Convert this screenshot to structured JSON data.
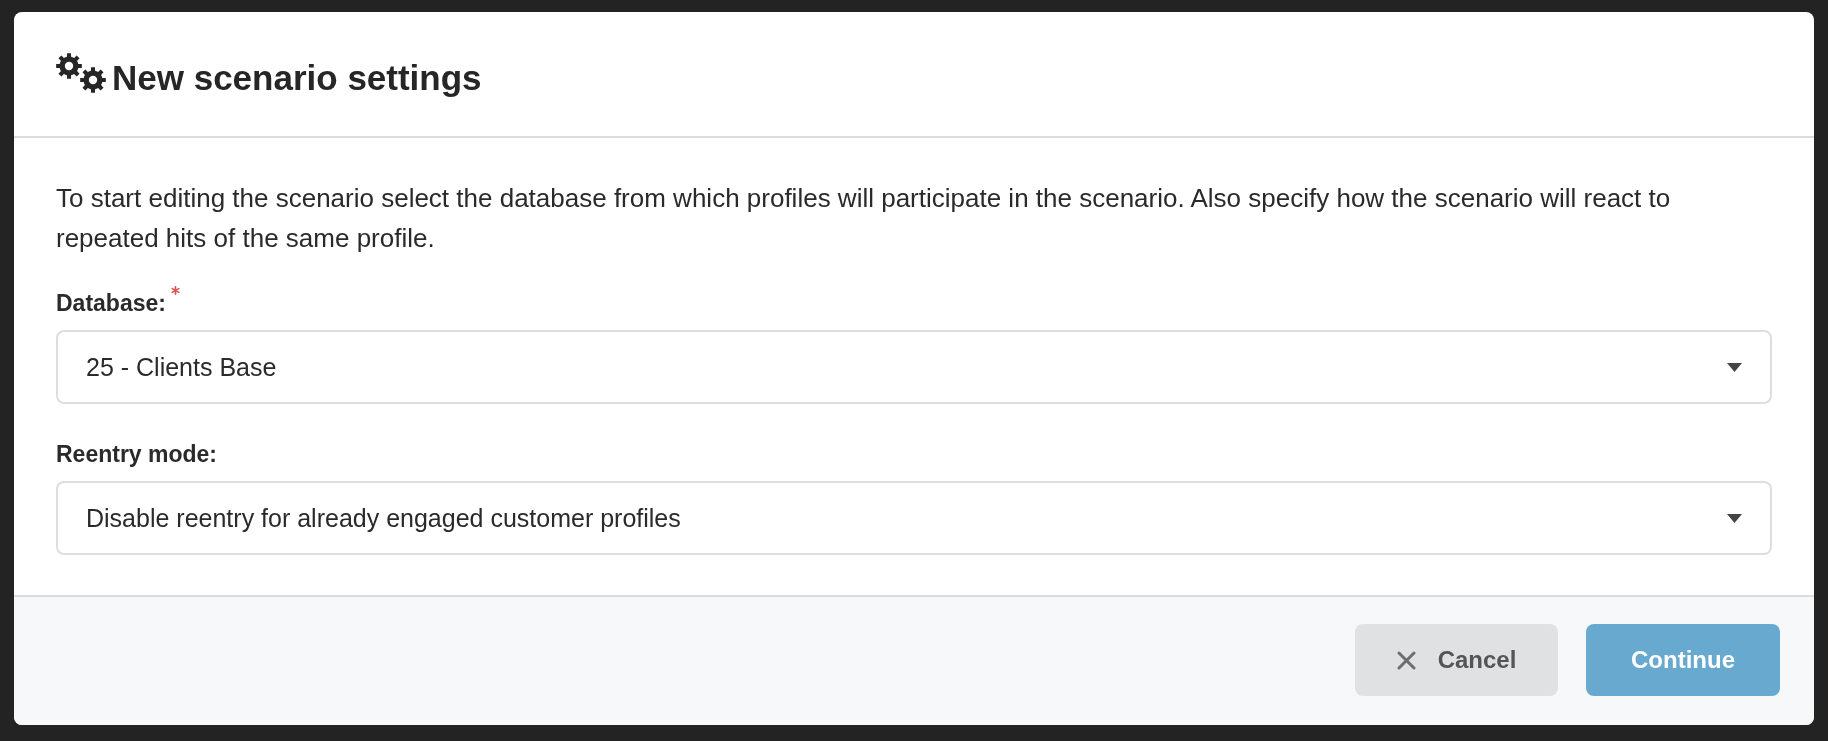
{
  "dialog": {
    "title": "New scenario settings"
  },
  "description": "To start editing the scenario select the database from which profiles will participate in the scenario. Also specify how the scenario will react to repeated hits of the same profile.",
  "fields": [
    {
      "label": "Database:",
      "required": true,
      "value": "25 - Clients Base"
    },
    {
      "label": "Reentry mode:",
      "required": false,
      "value": "Disable reentry for already engaged customer profiles"
    }
  ],
  "buttons": [
    {
      "label": "Cancel",
      "kind": "secondary"
    },
    {
      "label": "Continue",
      "kind": "primary"
    }
  ]
}
